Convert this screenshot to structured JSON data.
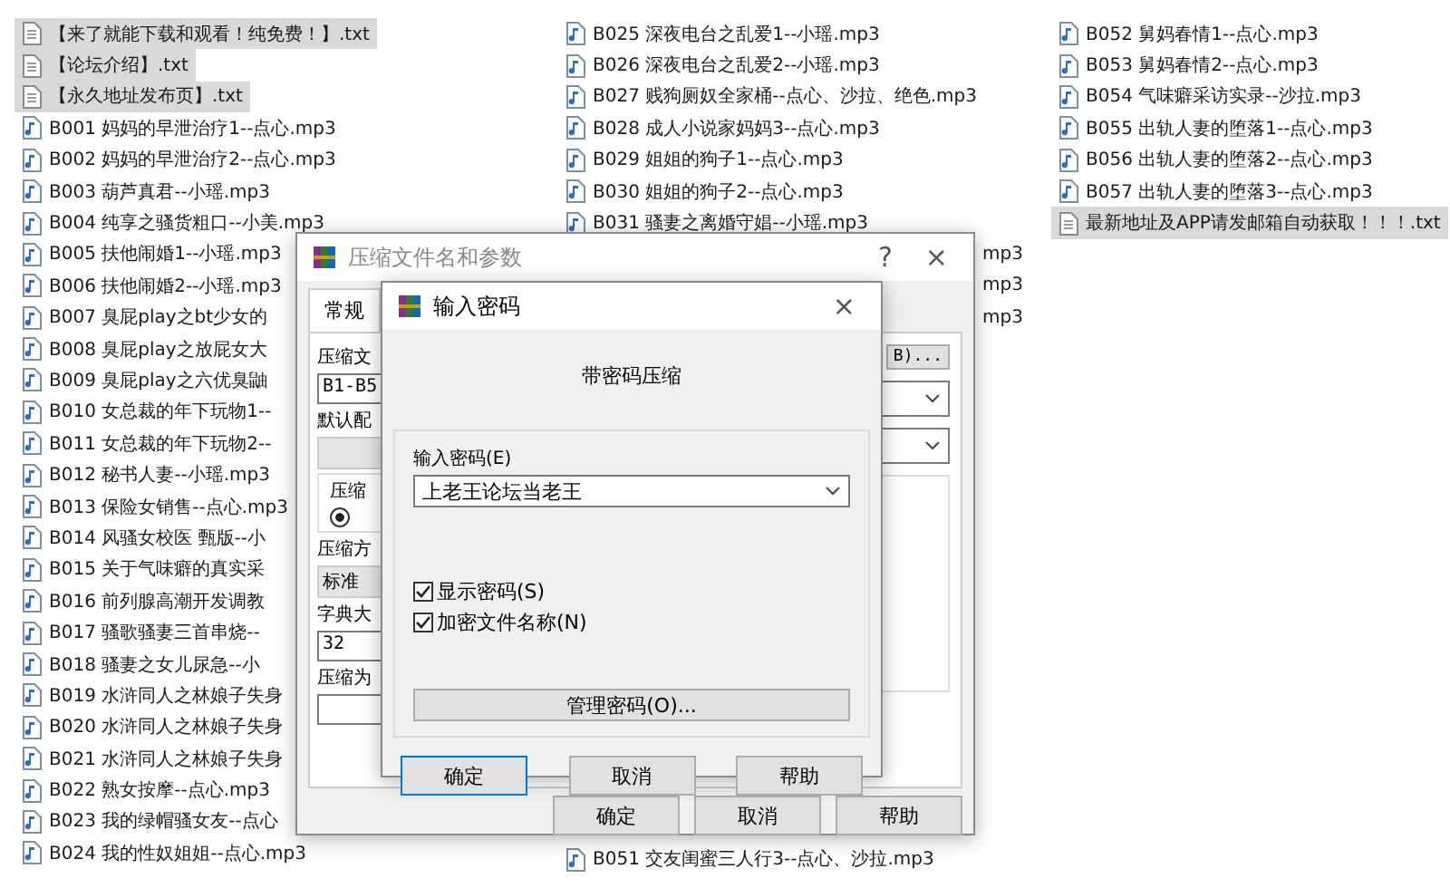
{
  "columns": [
    {
      "items": [
        {
          "kind": "txt",
          "name": "【来了就能下载和观看！纯免费！】.txt",
          "selected": true
        },
        {
          "kind": "txt",
          "name": "【论坛介绍】.txt",
          "selected": true
        },
        {
          "kind": "txt",
          "name": "【永久地址发布页】.txt",
          "selected": true
        },
        {
          "kind": "audio",
          "name": "B001 妈妈的早泄治疗1--点心.mp3",
          "selected": false
        },
        {
          "kind": "audio",
          "name": "B002 妈妈的早泄治疗2--点心.mp3",
          "selected": false
        },
        {
          "kind": "audio",
          "name": "B003 葫芦真君--小瑶.mp3",
          "selected": false
        },
        {
          "kind": "audio",
          "name": "B004 纯享之骚货粗口--小美.mp3",
          "selected": false
        },
        {
          "kind": "audio",
          "name": "B005 扶他闹婚1--小瑶.mp3",
          "selected": false
        },
        {
          "kind": "audio",
          "name": "B006 扶他闹婚2--小瑶.mp3",
          "selected": false
        },
        {
          "kind": "audio",
          "name": "B007 臭屁play之bt少女的",
          "selected": false
        },
        {
          "kind": "audio",
          "name": "B008 臭屁play之放屁女大",
          "selected": false
        },
        {
          "kind": "audio",
          "name": "B009 臭屁play之六优臭鼬",
          "selected": false
        },
        {
          "kind": "audio",
          "name": "B010 女总裁的年下玩物1--",
          "selected": false
        },
        {
          "kind": "audio",
          "name": "B011 女总裁的年下玩物2--",
          "selected": false
        },
        {
          "kind": "audio",
          "name": "B012 秘书人妻--小瑶.mp3",
          "selected": false
        },
        {
          "kind": "audio",
          "name": "B013 保险女销售--点心.mp3",
          "selected": false
        },
        {
          "kind": "audio",
          "name": "B014 风骚女校医 甄版--小",
          "selected": false
        },
        {
          "kind": "audio",
          "name": "B015 关于气味癖的真实采",
          "selected": false
        },
        {
          "kind": "audio",
          "name": "B016 前列腺高潮开发调教",
          "selected": false
        },
        {
          "kind": "audio",
          "name": "B017 骚歌骚妻三首串烧--",
          "selected": false
        },
        {
          "kind": "audio",
          "name": "B018 骚妻之女儿尿急--小",
          "selected": false
        },
        {
          "kind": "audio",
          "name": "B019 水浒同人之林娘子失身",
          "selected": false
        },
        {
          "kind": "audio",
          "name": "B020 水浒同人之林娘子失身",
          "selected": false
        },
        {
          "kind": "audio",
          "name": "B021 水浒同人之林娘子失身",
          "selected": false
        },
        {
          "kind": "audio",
          "name": "B022 熟女按摩--点心.mp3",
          "selected": false
        },
        {
          "kind": "audio",
          "name": "B023 我的绿帽骚女友--点心",
          "selected": false
        },
        {
          "kind": "audio",
          "name": "B024 我的性奴姐姐--点心.mp3",
          "selected": false
        }
      ]
    },
    {
      "items": [
        {
          "kind": "audio",
          "name": "B025 深夜电台之乱爱1--小瑶.mp3",
          "selected": false
        },
        {
          "kind": "audio",
          "name": "B026 深夜电台之乱爱2--小瑶.mp3",
          "selected": false
        },
        {
          "kind": "audio",
          "name": "B027 贱狗厕奴全家桶--点心、沙拉、绝色.mp3",
          "selected": false
        },
        {
          "kind": "audio",
          "name": "B028 成人小说家妈妈3--点心.mp3",
          "selected": false
        },
        {
          "kind": "audio",
          "name": "B029 姐姐的狗子1--点心.mp3",
          "selected": false
        },
        {
          "kind": "audio",
          "name": "B030 姐姐的狗子2--点心.mp3",
          "selected": false
        },
        {
          "kind": "audio",
          "name": "B031 骚妻之离婚守娼--小瑶.mp3",
          "selected": false
        },
        {
          "kind": "fragment",
          "name": "mp3",
          "selected": false
        },
        {
          "kind": "fragment",
          "name": "mp3",
          "selected": false
        },
        {
          "kind": "fragment",
          "name": "mp3",
          "selected": false
        }
      ],
      "bottom": [
        {
          "kind": "audio",
          "name": "B051 交友闺蜜三人行3--点心、沙拉.mp3",
          "selected": false
        }
      ]
    },
    {
      "items": [
        {
          "kind": "audio",
          "name": "B052 舅妈春情1--点心.mp3",
          "selected": false
        },
        {
          "kind": "audio",
          "name": "B053 舅妈春情2--点心.mp3",
          "selected": false
        },
        {
          "kind": "audio",
          "name": "B054 气味癖采访实录--沙拉.mp3",
          "selected": false
        },
        {
          "kind": "audio",
          "name": "B055 出轨人妻的堕落1--点心.mp3",
          "selected": false
        },
        {
          "kind": "audio",
          "name": "B056 出轨人妻的堕落2--点心.mp3",
          "selected": false
        },
        {
          "kind": "audio",
          "name": "B057 出轨人妻的堕落3--点心.mp3",
          "selected": false
        },
        {
          "kind": "txt",
          "name": "最新地址及APP请发邮箱自动获取！！！.txt",
          "selected": true
        }
      ]
    }
  ],
  "archive_dialog": {
    "title": "压缩文件名和参数",
    "help": "?",
    "close": "×",
    "tabs": [
      {
        "label": "常规",
        "selected": true
      }
    ],
    "labels": [
      "压缩文",
      "默认配",
      "压缩",
      "压缩方",
      "字典大",
      "压缩为"
    ],
    "browse_button": "B)...",
    "archive_name": "B1-B5",
    "method": "标准",
    "dictionary": "32",
    "radio": {
      "selected": true
    },
    "buttons": [
      "确定",
      "取消",
      "帮助"
    ]
  },
  "password_dialog": {
    "title": "输入密码",
    "close": "×",
    "heading": "带密码压缩",
    "password_label": "输入密码(E)",
    "password": "上老王论坛当老王",
    "options": [
      {
        "label": "显示密码(S)",
        "checked": true
      },
      {
        "label": "加密文件名称(N)",
        "checked": true
      }
    ],
    "manage_button": "管理密码(O)...",
    "buttons": [
      "确定",
      "取消",
      "帮助"
    ]
  }
}
